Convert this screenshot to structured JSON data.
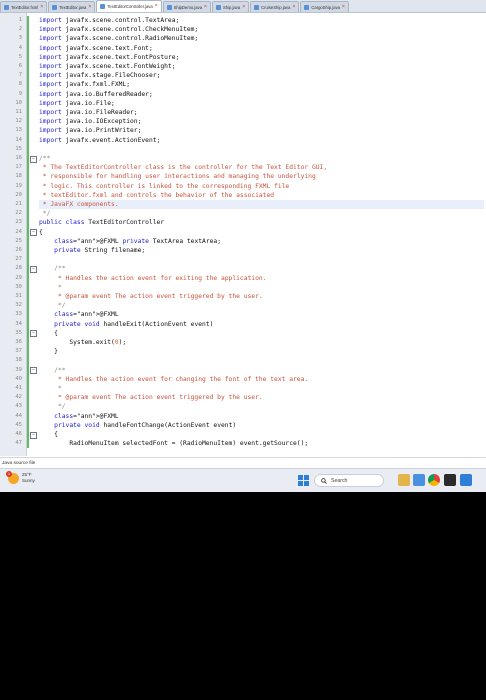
{
  "tabs": [
    {
      "label": "TextEditor.fxml",
      "active": false
    },
    {
      "label": "TextEditor.java",
      "active": false
    },
    {
      "label": "TextEditorController.java",
      "active": true
    },
    {
      "label": "ShipDemo.java",
      "active": false
    },
    {
      "label": "Ship.java",
      "active": false
    },
    {
      "label": "CruiseShip.java",
      "active": false
    },
    {
      "label": "CargoShip.java",
      "active": false
    }
  ],
  "code_lines": [
    {
      "n": "1",
      "t": "import javafx.scene.control.TextArea;"
    },
    {
      "n": "2",
      "t": "import javafx.scene.control.CheckMenuItem;"
    },
    {
      "n": "3",
      "t": "import javafx.scene.control.RadioMenuItem;"
    },
    {
      "n": "4",
      "t": "import javafx.scene.text.Font;"
    },
    {
      "n": "5",
      "t": "import javafx.scene.text.FontPosture;"
    },
    {
      "n": "6",
      "t": "import javafx.scene.text.FontWeight;"
    },
    {
      "n": "7",
      "t": "import javafx.stage.FileChooser;"
    },
    {
      "n": "8",
      "t": "import javafx.fxml.FXML;"
    },
    {
      "n": "9",
      "t": "import java.io.BufferedReader;"
    },
    {
      "n": "10",
      "t": "import java.io.File;"
    },
    {
      "n": "11",
      "t": "import java.io.FileReader;"
    },
    {
      "n": "12",
      "t": "import java.io.IOException;"
    },
    {
      "n": "13",
      "t": "import java.io.PrintWriter;"
    },
    {
      "n": "14",
      "t": "import javafx.event.ActionEvent;"
    },
    {
      "n": "15",
      "t": ""
    },
    {
      "n": "16",
      "t": "/**"
    },
    {
      "n": "17",
      "t": " * The TextEditorController class is the controller for the Text Editor GUI,"
    },
    {
      "n": "18",
      "t": " * responsible for handling user interactions and managing the underlying"
    },
    {
      "n": "19",
      "t": " * logic. This controller is linked to the corresponding FXML file"
    },
    {
      "n": "20",
      "t": " * textEditor.fxml and controls the behavior of the associated"
    },
    {
      "n": "21",
      "t": " * JavaFX components."
    },
    {
      "n": "22",
      "t": " */"
    },
    {
      "n": "23",
      "t": "public class TextEditorController"
    },
    {
      "n": "24",
      "t": "{"
    },
    {
      "n": "25",
      "t": "    @FXML private TextArea textArea;"
    },
    {
      "n": "26",
      "t": "    private String filename;"
    },
    {
      "n": "27",
      "t": ""
    },
    {
      "n": "28",
      "t": "    /**"
    },
    {
      "n": "29",
      "t": "     * Handles the action event for exiting the application."
    },
    {
      "n": "30",
      "t": "     *"
    },
    {
      "n": "31",
      "t": "     * @param event The action event triggered by the user."
    },
    {
      "n": "32",
      "t": "     */"
    },
    {
      "n": "33",
      "t": "    @FXML"
    },
    {
      "n": "34",
      "t": "    private void handleExit(ActionEvent event)"
    },
    {
      "n": "35",
      "t": "    {"
    },
    {
      "n": "36",
      "t": "        System.exit(0);"
    },
    {
      "n": "37",
      "t": "    }"
    },
    {
      "n": "38",
      "t": ""
    },
    {
      "n": "39",
      "t": "    /**"
    },
    {
      "n": "40",
      "t": "     * Handles the action event for changing the font of the text area."
    },
    {
      "n": "41",
      "t": "     *"
    },
    {
      "n": "42",
      "t": "     * @param event The action event triggered by the user."
    },
    {
      "n": "43",
      "t": "     */"
    },
    {
      "n": "44",
      "t": "    @FXML"
    },
    {
      "n": "45",
      "t": "    private void handleFontChange(ActionEvent event)"
    },
    {
      "n": "46",
      "t": "    {"
    },
    {
      "n": "47",
      "t": "        RadioMenuItem selectedFont = (RadioMenuItem) event.getSource();"
    }
  ],
  "status": {
    "file_type": "Java source file"
  },
  "taskbar": {
    "weather_temp": "25°F",
    "weather_desc": "Sunny",
    "weather_badge": "1",
    "search_label": "Search"
  },
  "colors": {
    "keyword": "#1a1acc",
    "comment": "#c8523b",
    "number": "#d45d2a",
    "accent": "#2f7ed8"
  }
}
